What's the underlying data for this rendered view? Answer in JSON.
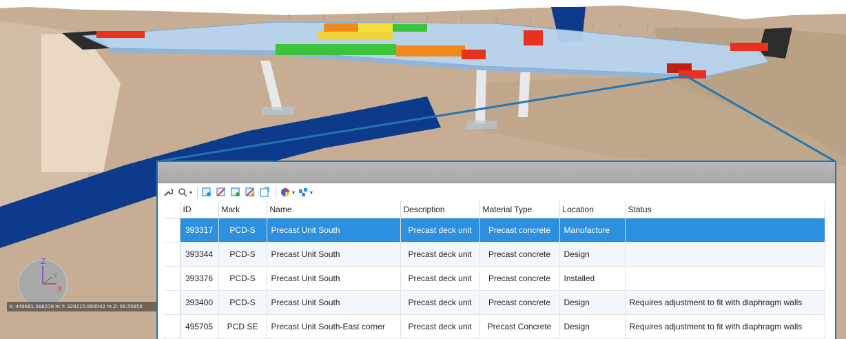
{
  "viewport": {
    "coordinate_readout": "X: 449661.566078 m Y: 329115.890042 m Z: 56.50856",
    "axis_labels": {
      "z": "Z",
      "y": "Y",
      "x": "X"
    }
  },
  "toolbar": {
    "icons": [
      "wrench-icon",
      "search-icon",
      "add-selection-icon",
      "remove-selection-icon",
      "add-to-group-icon",
      "remove-from-group-icon",
      "select-highlighted-icon",
      "color-scheme-icon",
      "assign-icon"
    ]
  },
  "table": {
    "columns": [
      "ID",
      "Mark",
      "Name",
      "Description",
      "Material Type",
      "Location",
      "Status"
    ],
    "rows": [
      {
        "id": "393317",
        "mark": "PCD-S",
        "name": "Precast Unit South",
        "description": "Precast deck unit",
        "material": "Precast concrete",
        "location": "Manufacture",
        "status": "",
        "selected": true
      },
      {
        "id": "393344",
        "mark": "PCD-S",
        "name": "Precast Unit South",
        "description": "Precast deck unit",
        "material": "Precast concrete",
        "location": "Design",
        "status": ""
      },
      {
        "id": "393376",
        "mark": "PCD-S",
        "name": "Precast Unit South",
        "description": "Precast deck unit",
        "material": "Precast concrete",
        "location": "Installed",
        "status": ""
      },
      {
        "id": "393400",
        "mark": "PCD-S",
        "name": "Precast Unit South",
        "description": "Precast deck unit",
        "material": "Precast concrete",
        "location": "Design",
        "status": "Requires adjustment to fit with diaphragm walls"
      },
      {
        "id": "495705",
        "mark": "PCD SE",
        "name": "Precast Unit South-East corner",
        "description": "Precast deck unit",
        "material": "Precast Concrete",
        "location": "Design",
        "status": "Requires adjustment to fit with diaphragm walls"
      }
    ]
  },
  "colors": {
    "terrain": "#c3ab92",
    "river": "#0d3a8a",
    "selection": "#2d8fe0",
    "callout": "#1f77b4",
    "status_red": "#e8321e",
    "status_orange": "#f08a1c",
    "status_yellow": "#f4e23a",
    "status_green": "#3cc43c"
  }
}
